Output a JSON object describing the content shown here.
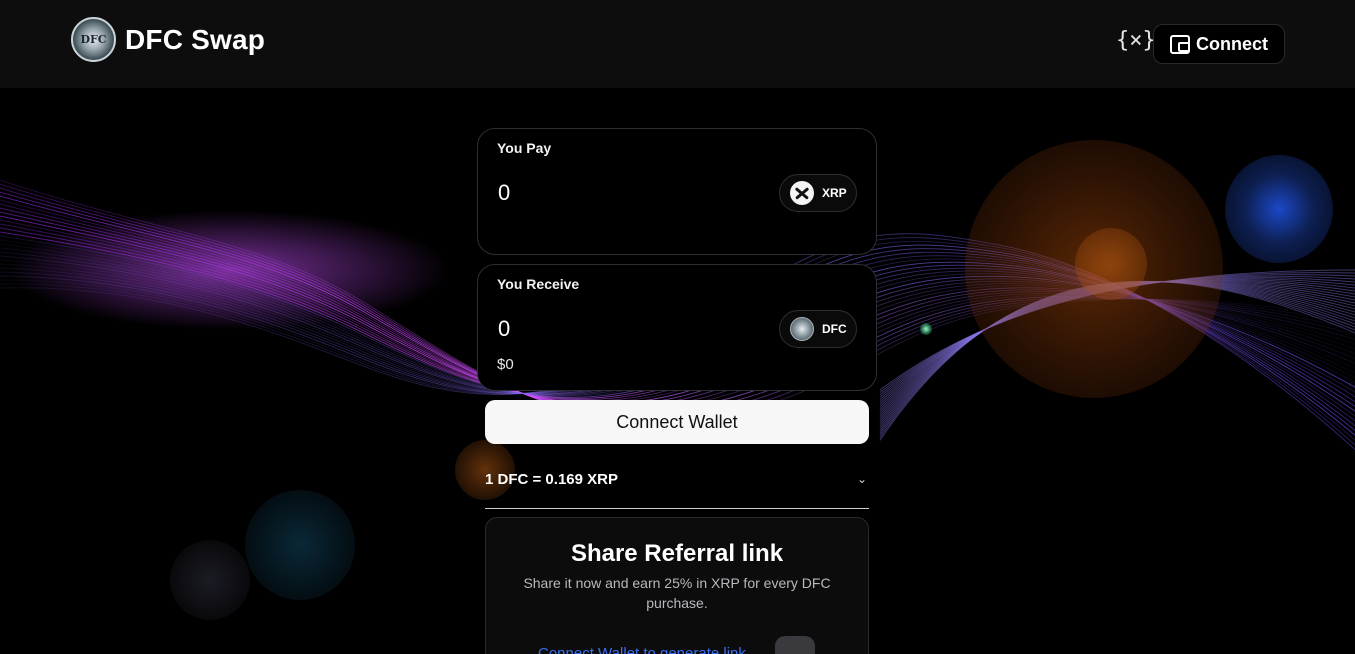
{
  "header": {
    "logo_text": "DFC",
    "brand": "DFC Swap",
    "curly_icon": "{×}",
    "connect_label": "Connect"
  },
  "swap": {
    "pay": {
      "label": "You Pay",
      "amount": "0",
      "token": "XRP",
      "token_icon": "xrp-icon"
    },
    "receive": {
      "label": "You Receive",
      "amount": "0",
      "usd_value": "$0",
      "token": "DFC",
      "token_icon": "dfc-icon"
    },
    "connect_wallet_label": "Connect Wallet",
    "rate": "1 DFC = 0.169 XRP"
  },
  "referral": {
    "title": "Share Referral link",
    "description": "Share it now and earn 25% in XRP for every DFC purchase.",
    "link_text": "Connect Wallet to generate link"
  },
  "colors": {
    "background": "#000000",
    "header_bg": "#0d0d0e",
    "link": "#3b6ff2",
    "wave_purple": "#b43cf0"
  }
}
